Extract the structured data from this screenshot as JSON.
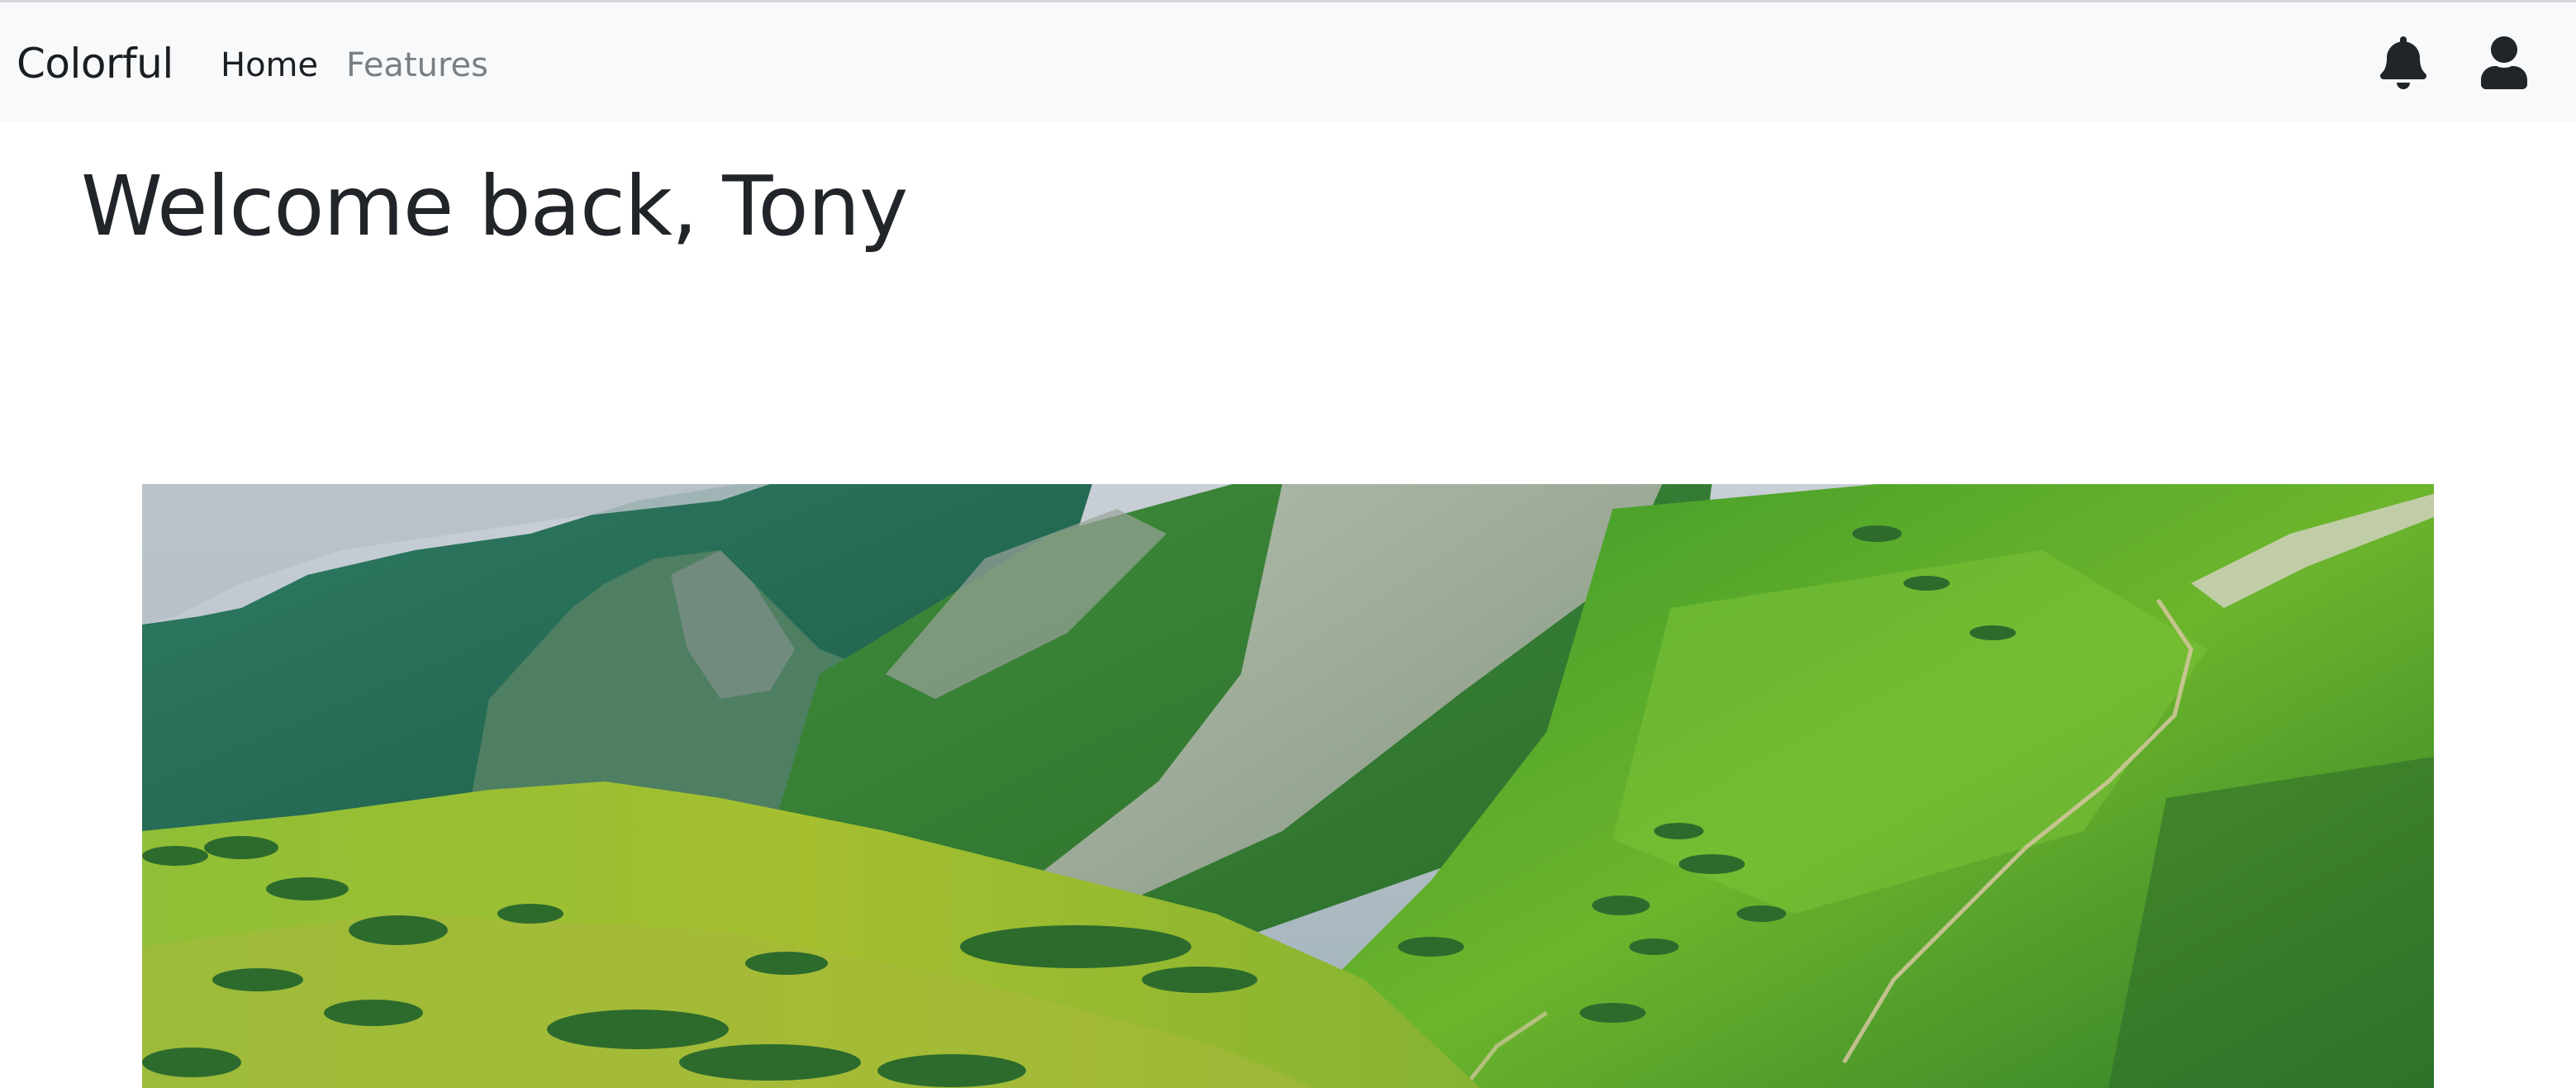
{
  "navbar": {
    "brand": "Colorful",
    "links": [
      {
        "label": "Home",
        "active": true
      },
      {
        "label": "Features",
        "active": false
      }
    ],
    "icons": [
      "bell-icon",
      "user-icon"
    ],
    "background": "#f8f9fa"
  },
  "main": {
    "headline": "Welcome back, Tony"
  },
  "colors": {
    "text": "#212529",
    "muted_link": "#7a7f85",
    "grass": "#7fba2a",
    "forest": "#1e6b3a"
  }
}
